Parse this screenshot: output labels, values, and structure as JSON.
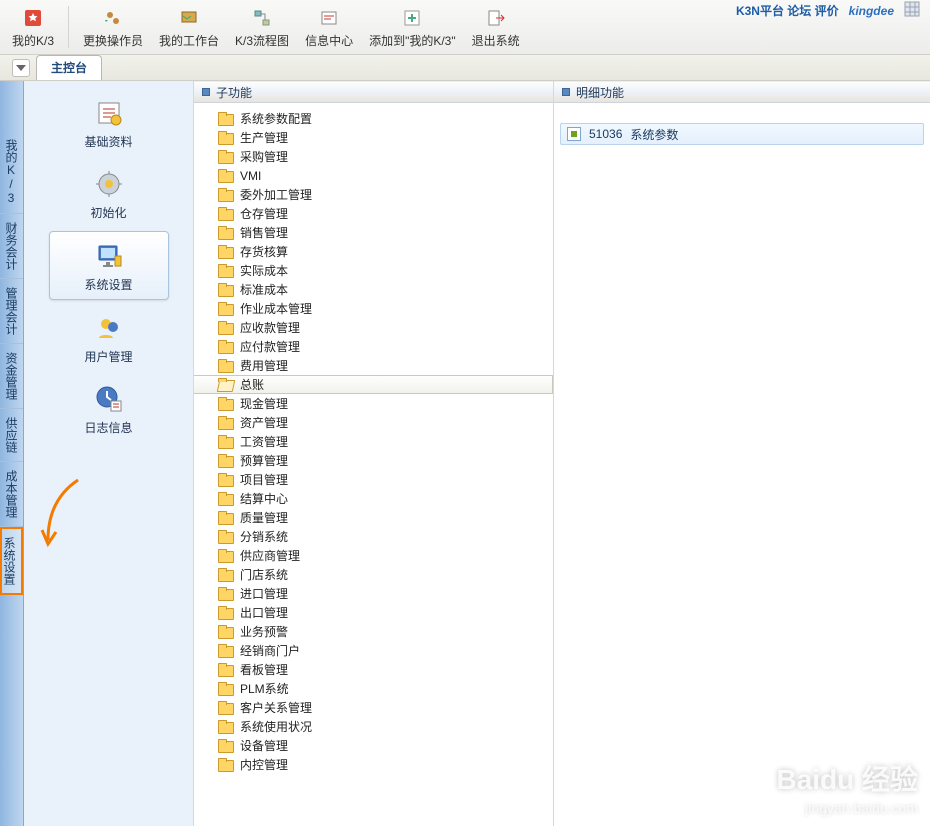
{
  "toolbar": {
    "items": [
      {
        "label": "我的K/3",
        "icon": "star"
      },
      {
        "label": "更换操作员",
        "icon": "user-swap"
      },
      {
        "label": "我的工作台",
        "icon": "workbench"
      },
      {
        "label": "K/3流程图",
        "icon": "flow"
      },
      {
        "label": "信息中心",
        "icon": "info-center"
      },
      {
        "label": "添加到\"我的K/3\"",
        "icon": "add"
      },
      {
        "label": "退出系统",
        "icon": "exit"
      }
    ],
    "right": {
      "k3n": "K3N平台 论坛 评价",
      "brand": "kingdee"
    }
  },
  "tabs": {
    "active": "主控台"
  },
  "left_vertical_nav": [
    {
      "label": "我的K/3"
    },
    {
      "label": "财务会计"
    },
    {
      "label": "管理会计"
    },
    {
      "label": "资金管理"
    },
    {
      "label": "供应链"
    },
    {
      "label": "成本管理"
    },
    {
      "label": "系统设置",
      "highlight": true
    }
  ],
  "mid_nav": [
    {
      "label": "基础资料"
    },
    {
      "label": "初始化"
    },
    {
      "label": "系统设置",
      "selected": true
    },
    {
      "label": "用户管理"
    },
    {
      "label": "日志信息"
    }
  ],
  "columns": {
    "sub_header": "子功能",
    "detail_header": "明细功能"
  },
  "tree_items": [
    "系统参数配置",
    "生产管理",
    "采购管理",
    "VMI",
    "委外加工管理",
    "仓存管理",
    "销售管理",
    "存货核算",
    "实际成本",
    "标准成本",
    "作业成本管理",
    "应收款管理",
    "应付款管理",
    "费用管理",
    "总账",
    "现金管理",
    "资产管理",
    "工资管理",
    "预算管理",
    "项目管理",
    "结算中心",
    "质量管理",
    "分销系统",
    "供应商管理",
    "门店系统",
    "进口管理",
    "出口管理",
    "业务预警",
    "经销商门户",
    "看板管理",
    "PLM系统",
    "客户关系管理",
    "系统使用状况",
    "设备管理",
    "内控管理"
  ],
  "tree_selected": "总账",
  "detail_items": [
    {
      "code": "51036",
      "name": "系统参数"
    }
  ],
  "watermark": {
    "big": "Baidu 经验",
    "small": "jingyan.baidu.com"
  }
}
